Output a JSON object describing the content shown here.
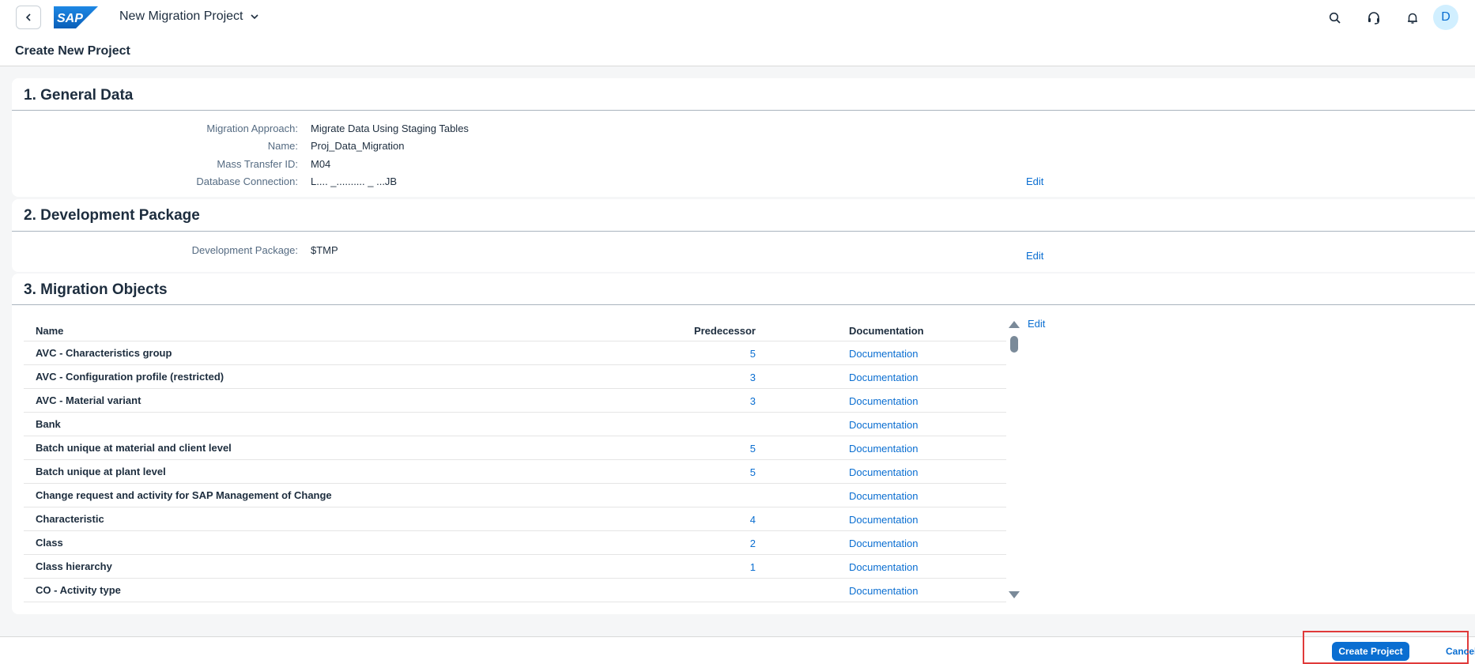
{
  "shell": {
    "logo_text": "SAP",
    "app_title": "New Migration Project",
    "avatar_initial": "D",
    "icons": [
      "search-icon",
      "headset-icon",
      "bell-icon"
    ]
  },
  "page": {
    "title": "Create New Project"
  },
  "general": {
    "title": "1. General Data",
    "fields": [
      {
        "label": "Migration Approach:",
        "value": "Migrate Data Using Staging Tables"
      },
      {
        "label": "Name:",
        "value": "Proj_Data_Migration"
      },
      {
        "label": "Mass Transfer ID:",
        "value": "M04"
      },
      {
        "label": "Database Connection:",
        "value": "L.... _.......... _ ...JB"
      }
    ],
    "edit_label": "Edit"
  },
  "devpkg": {
    "title": "2. Development Package",
    "fields": [
      {
        "label": "Development Package:",
        "value": "$TMP"
      }
    ],
    "edit_label": "Edit"
  },
  "migration": {
    "title": "3. Migration Objects",
    "edit_label": "Edit",
    "columns": {
      "name": "Name",
      "predecessor": "Predecessor",
      "documentation": "Documentation"
    },
    "rows": [
      {
        "name": "AVC - Characteristics group",
        "predecessor": "5",
        "documentation": "Documentation"
      },
      {
        "name": "AVC - Configuration profile (restricted)",
        "predecessor": "3",
        "documentation": "Documentation"
      },
      {
        "name": "AVC - Material variant",
        "predecessor": "3",
        "documentation": "Documentation"
      },
      {
        "name": "Bank",
        "predecessor": "",
        "documentation": "Documentation"
      },
      {
        "name": "Batch unique at material and client level",
        "predecessor": "5",
        "documentation": "Documentation"
      },
      {
        "name": "Batch unique at plant level",
        "predecessor": "5",
        "documentation": "Documentation"
      },
      {
        "name": "Change request and activity for SAP Management of Change",
        "predecessor": "",
        "documentation": "Documentation"
      },
      {
        "name": "Characteristic",
        "predecessor": "4",
        "documentation": "Documentation"
      },
      {
        "name": "Class",
        "predecessor": "2",
        "documentation": "Documentation"
      },
      {
        "name": "Class hierarchy",
        "predecessor": "1",
        "documentation": "Documentation"
      },
      {
        "name": "CO - Activity type",
        "predecessor": "",
        "documentation": "Documentation"
      }
    ]
  },
  "footer": {
    "create_label": "Create Project",
    "cancel_label": "Cancel"
  },
  "colors": {
    "accent": "#0a6ed1",
    "highlight": "#e03a3a",
    "logo": "#0a6ed1"
  }
}
